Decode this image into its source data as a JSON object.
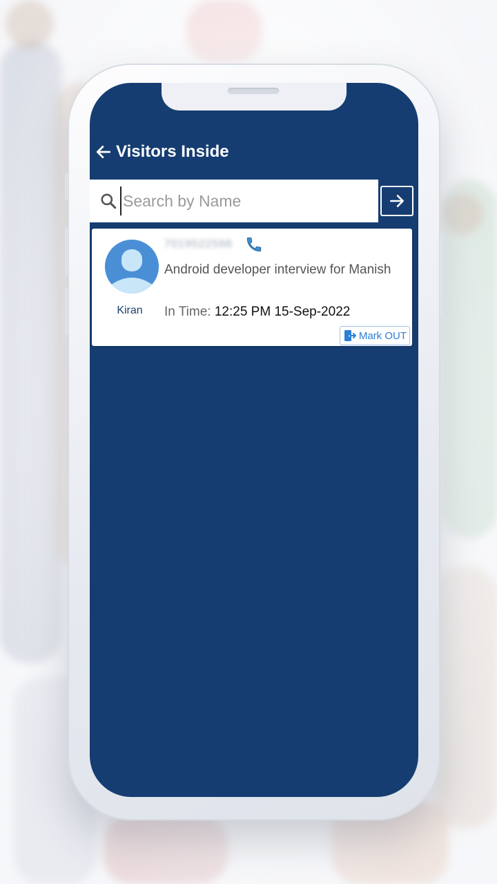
{
  "app": {
    "title": "Visitors Inside",
    "back_icon": "arrow-left-icon"
  },
  "search": {
    "placeholder": "Search by Name",
    "value": "",
    "icon": "search-icon",
    "go_icon": "arrow-right-icon"
  },
  "visitors": [
    {
      "name": "Kiran",
      "phone": "7019522566",
      "phone_icon": "phone-icon",
      "purpose": "Android developer interview for Manish",
      "in_time_label": "In Time:",
      "in_time": "12:25 PM 15-Sep-2022",
      "mark_out_label": "Mark OUT",
      "mark_out_icon": "exit-door-icon"
    }
  ],
  "colors": {
    "primary": "#163d72",
    "accent": "#2a7fd4",
    "card_bg": "#ffffff"
  }
}
